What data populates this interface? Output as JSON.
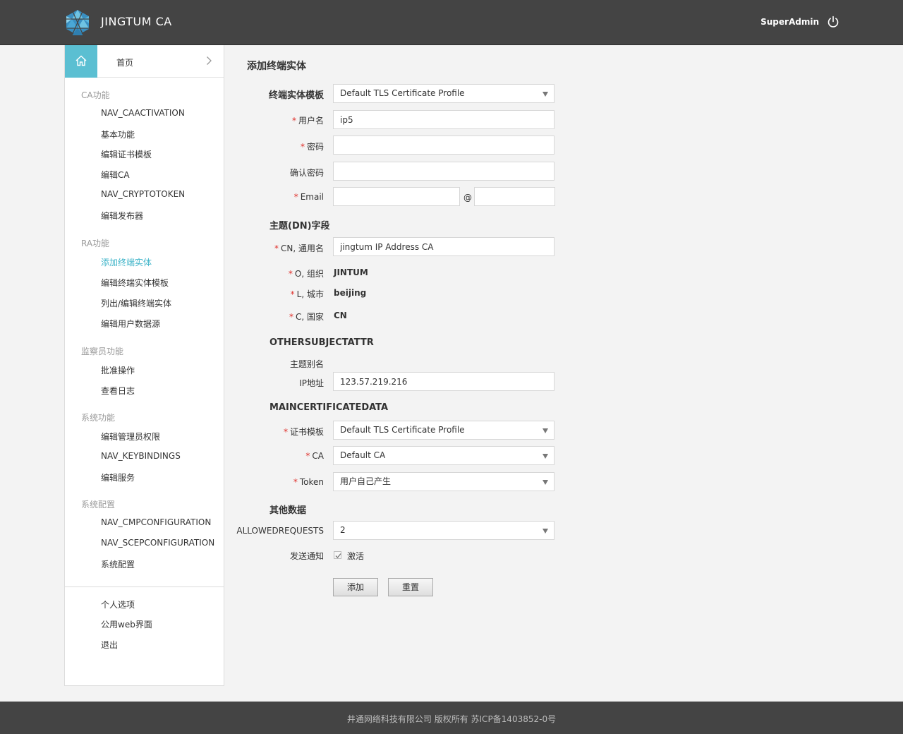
{
  "colors": {
    "header_bg": "#444444",
    "accent": "#5bbfd2",
    "required": "#e0302b"
  },
  "header": {
    "brand": "JINGTUM CA",
    "user": "SuperAdmin",
    "logo_icon": "hexagon-triangles-logo",
    "power_icon": "power-icon"
  },
  "sidebar": {
    "home_label": "首页",
    "groups": [
      {
        "title": "CA功能",
        "items": [
          "NAV_CAACTIVATION",
          "基本功能",
          "编辑证书模板",
          "编辑CA",
          "NAV_CRYPTOTOKEN",
          "编辑发布器"
        ]
      },
      {
        "title": "RA功能",
        "items": [
          "添加终端实体",
          "编辑终端实体模板",
          "列出/编辑终端实体",
          "编辑用户数据源"
        ]
      },
      {
        "title": "监察员功能",
        "items": [
          "批准操作",
          "查看日志"
        ]
      },
      {
        "title": "系统功能",
        "items": [
          "编辑管理员权限",
          "NAV_KEYBINDINGS",
          "编辑服务"
        ]
      },
      {
        "title": "系统配置",
        "items": [
          "NAV_CMPCONFIGURATION",
          "NAV_SCEPCONFIGURATION",
          "系统配置"
        ]
      }
    ],
    "active_item": "添加终端实体",
    "bottom_items": [
      "个人选项",
      "公用web界面",
      "退出"
    ]
  },
  "main": {
    "title": "添加终端实体",
    "profile_label": "终端实体模板",
    "profile_value": "Default TLS Certificate Profile",
    "username_label": "用户名",
    "username_value": "ip5",
    "password_label": "密码",
    "confirm_label": "确认密码",
    "email_label": "Email",
    "email_at": "@",
    "dn_section": "主题(DN)字段",
    "cn_label": "CN, 通用名",
    "cn_value": "jingtum IP Address CA",
    "o_label": "O, 组织",
    "o_value": "JINTUM",
    "l_label": "L, 城市",
    "l_value": "beijing",
    "c_label": "C, 国家",
    "c_value": "CN",
    "other_section": "OTHERSUBJECTATTR",
    "altname_label": "主题别名",
    "ip_label": "IP地址",
    "ip_value": "123.57.219.216",
    "main_cert_section": "MAINCERTIFICATEDATA",
    "cert_profile_label": "证书模板",
    "cert_profile_value": "Default TLS Certificate Profile",
    "ca_label": "CA",
    "ca_value": "Default CA",
    "token_label": "Token",
    "token_value": "用户自己产生",
    "other_data_section": "其他数据",
    "allowed_label": "ALLOWEDREQUESTS",
    "allowed_value": "2",
    "notify_label": "发送通知",
    "notify_option": "激活",
    "notify_checked": true,
    "add_button": "添加",
    "reset_button": "重置",
    "required_mark": "*"
  },
  "footer": {
    "text": "井通网络科技有限公司 版权所有 苏ICP备1403852-0号"
  }
}
